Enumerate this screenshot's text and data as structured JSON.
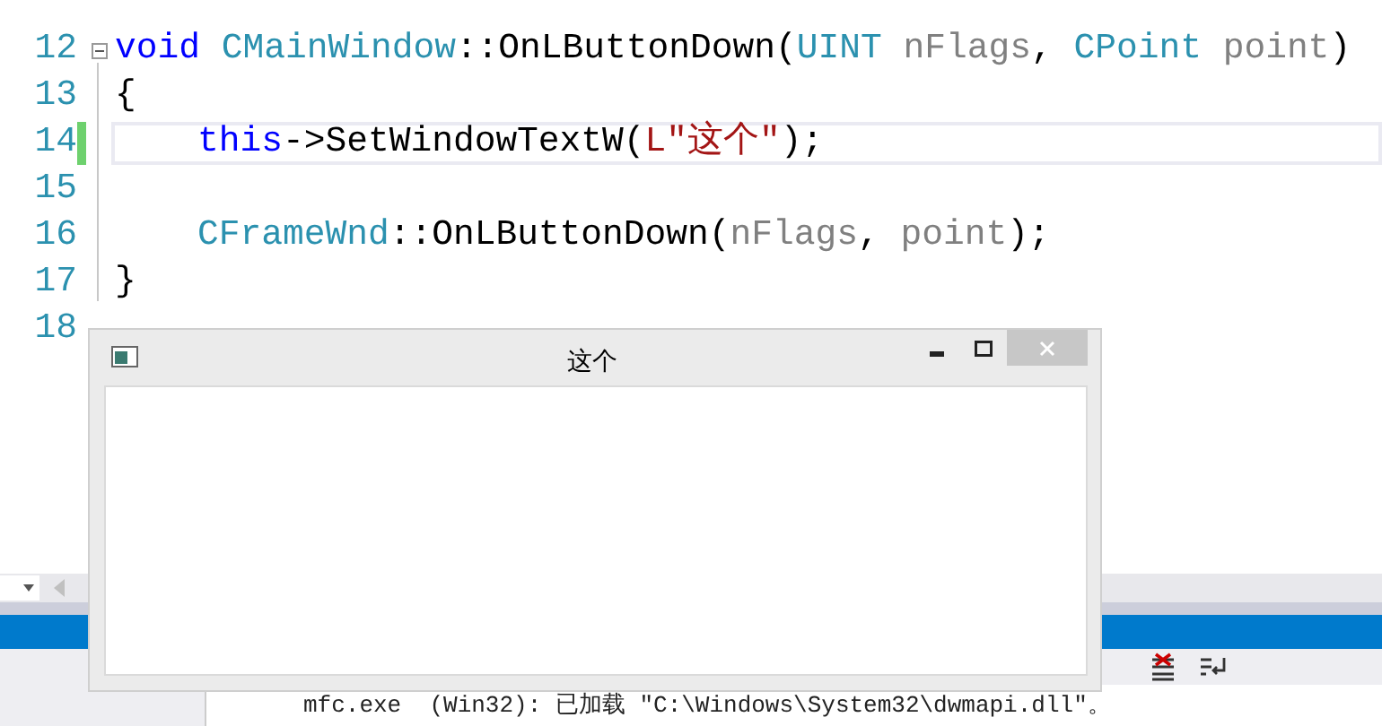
{
  "editor": {
    "lines": [
      {
        "number": "12",
        "foldable": true,
        "current": false,
        "changed": false,
        "indented": false,
        "tokens": [
          {
            "kind": "keyword",
            "text": "void "
          },
          {
            "kind": "type",
            "text": "CMainWindow"
          },
          {
            "kind": "plain",
            "text": "::OnLButtonDown("
          },
          {
            "kind": "type",
            "text": "UINT "
          },
          {
            "kind": "param",
            "text": "nFlags"
          },
          {
            "kind": "plain",
            "text": ", "
          },
          {
            "kind": "type",
            "text": "CPoint "
          },
          {
            "kind": "param",
            "text": "point"
          },
          {
            "kind": "plain",
            "text": ")"
          }
        ]
      },
      {
        "number": "13",
        "foldable": false,
        "current": false,
        "changed": false,
        "indented": false,
        "tokens": [
          {
            "kind": "plain",
            "text": "{"
          }
        ]
      },
      {
        "number": "14",
        "foldable": false,
        "current": true,
        "changed": true,
        "indented": true,
        "tokens": [
          {
            "kind": "keyword",
            "text": "this"
          },
          {
            "kind": "plain",
            "text": "->SetWindowTextW("
          },
          {
            "kind": "string",
            "text": "L\"这个\""
          },
          {
            "kind": "plain",
            "text": ");"
          }
        ]
      },
      {
        "number": "15",
        "foldable": false,
        "current": false,
        "changed": false
      },
      {
        "number": "16",
        "foldable": false,
        "current": false,
        "changed": false,
        "indented": true,
        "tokens": [
          {
            "kind": "type",
            "text": "CFrameWnd"
          },
          {
            "kind": "plain",
            "text": "::OnLButtonDown("
          },
          {
            "kind": "param",
            "text": "nFlags"
          },
          {
            "kind": "plain",
            "text": ", "
          },
          {
            "kind": "param",
            "text": "point"
          },
          {
            "kind": "plain",
            "text": ");"
          }
        ]
      },
      {
        "number": "17",
        "foldable": false,
        "current": false,
        "changed": false,
        "indented": false,
        "tokens": [
          {
            "kind": "plain",
            "text": "}"
          }
        ]
      },
      {
        "number": "18",
        "foldable": false,
        "current": false,
        "changed": false
      }
    ]
  },
  "dialog": {
    "title": "这个"
  },
  "output": {
    "line": "mfc.exe  (Win32): 已加载 \"C:\\Windows\\System32\\dwmapi.dll\"。"
  }
}
